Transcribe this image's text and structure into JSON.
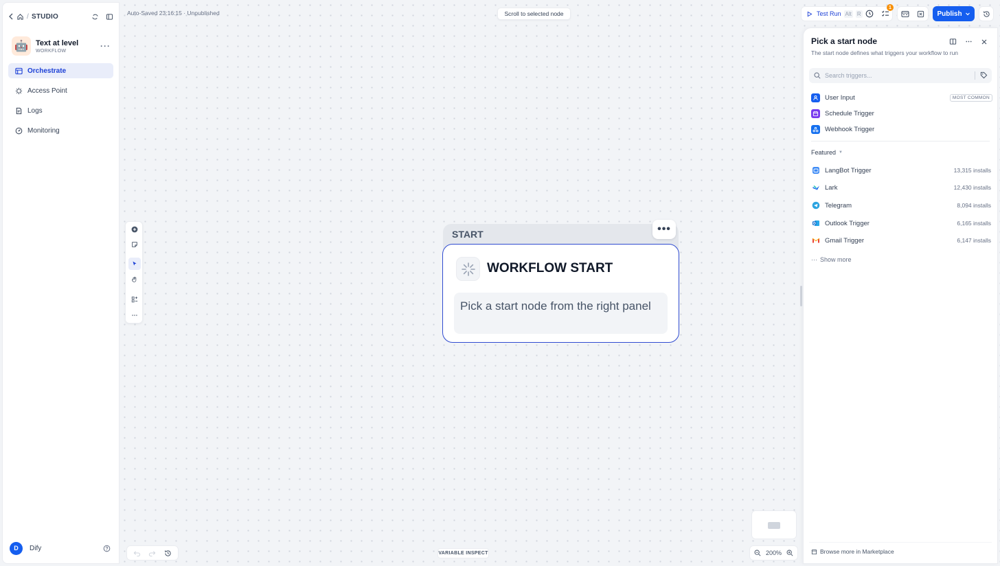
{
  "sidebar": {
    "breadcrumb": "STUDIO",
    "app": {
      "name": "Text at level",
      "type": "WORKFLOW",
      "emoji": "🤖"
    },
    "nav": [
      {
        "label": "Orchestrate",
        "icon": "orchestrate-icon",
        "active": true
      },
      {
        "label": "Access Point",
        "icon": "access-point-icon",
        "active": false
      },
      {
        "label": "Logs",
        "icon": "logs-icon",
        "active": false
      },
      {
        "label": "Monitoring",
        "icon": "monitoring-icon",
        "active": false
      }
    ],
    "workspace": {
      "initial": "D",
      "name": "Dify"
    }
  },
  "header": {
    "autosave": "Auto-Saved 23:16:15 · Unpublished",
    "scroll_to_selected": "Scroll to selected node",
    "test_run": {
      "label": "Test Run",
      "key1": "Alt",
      "key2": "R"
    },
    "badge_count": "1",
    "publish": "Publish"
  },
  "node": {
    "header_label": "START",
    "title": "WORKFLOW START",
    "body": "Pick a start node from the right panel"
  },
  "bottom": {
    "variable_inspect": "VARIABLE INSPECT",
    "zoom": "200%"
  },
  "panel": {
    "title": "Pick a start node",
    "subtitle": "The start node defines what triggers your workflow to run",
    "search_placeholder": "Search triggers...",
    "triggers": [
      {
        "label": "User Input",
        "badge": "MOST COMMON",
        "color": "#155eef"
      },
      {
        "label": "Schedule Trigger",
        "badge": "",
        "color": "#7839ee"
      },
      {
        "label": "Webhook Trigger",
        "badge": "",
        "color": "#1570ef"
      }
    ],
    "featured_label": "Featured",
    "featured": [
      {
        "label": "LangBot Trigger",
        "installs": "13,315 installs",
        "color": "#3e8bf5"
      },
      {
        "label": "Lark",
        "installs": "12,430 installs",
        "color": "#1f6feb"
      },
      {
        "label": "Telegram",
        "installs": "8,094 installs",
        "color": "#2aa3e0"
      },
      {
        "label": "Outlook Trigger",
        "installs": "6,165 installs",
        "color": "#0a64c9"
      },
      {
        "label": "Gmail Trigger",
        "installs": "6,147 installs",
        "color": "#ea4335"
      }
    ],
    "show_more": "Show more",
    "browse_more": "Browse more in Marketplace"
  },
  "colors": {
    "accent": "#155eef",
    "active_nav_bg": "#e9edfa",
    "node_border": "#2f4bd0",
    "badge": "#f79009"
  }
}
